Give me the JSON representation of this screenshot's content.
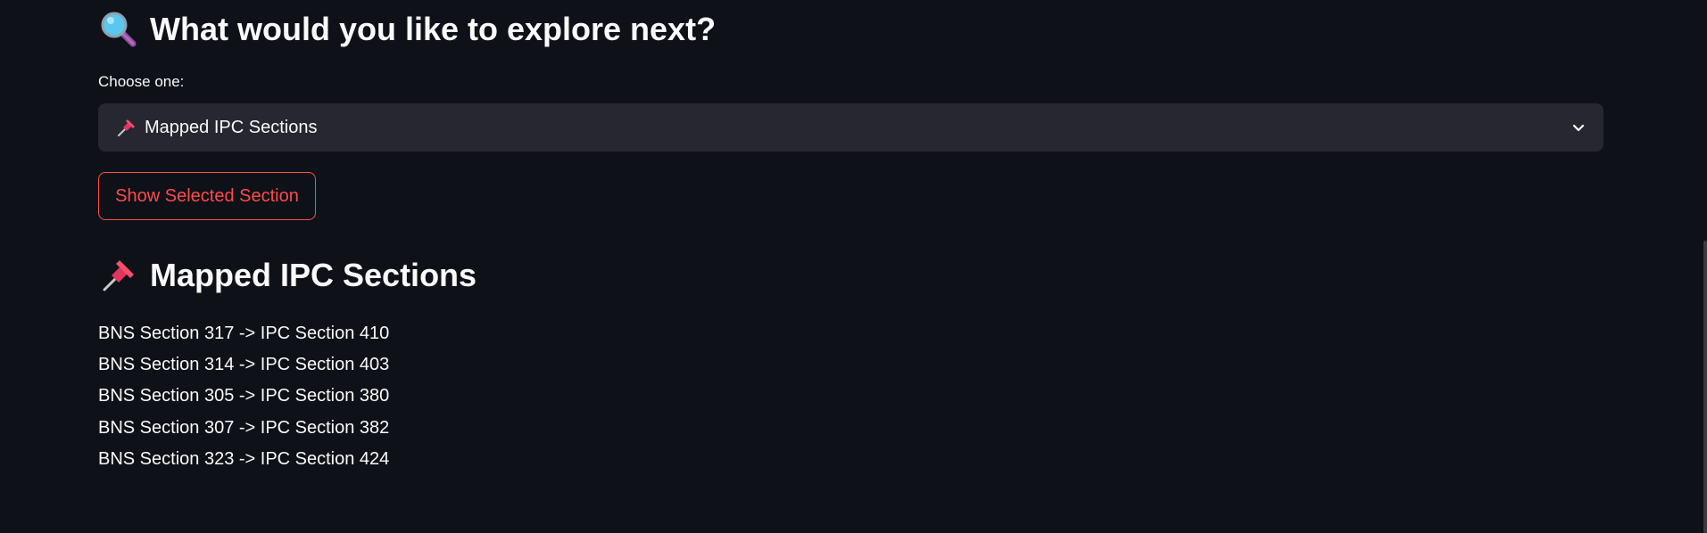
{
  "explore": {
    "heading": "What would you like to explore next?",
    "heading_icon": "magnifying-glass-icon"
  },
  "selector": {
    "label": "Choose one:",
    "selected_icon": "pushpin-icon",
    "selected_value": "Mapped IPC Sections"
  },
  "show_button": {
    "label": "Show Selected Section",
    "color": "#ff4b4b"
  },
  "section": {
    "icon": "pushpin-icon",
    "title": "Mapped IPC Sections",
    "mappings": [
      "BNS Section 317 -> IPC Section 410",
      "BNS Section 314 -> IPC Section 403",
      "BNS Section 305 -> IPC Section 380",
      "BNS Section 307 -> IPC Section 382",
      "BNS Section 323 -> IPC Section 424"
    ]
  },
  "theme": {
    "background": "#0e1117",
    "select_background": "#262730",
    "text": "#fafafa",
    "accent": "#ff4b4b"
  }
}
